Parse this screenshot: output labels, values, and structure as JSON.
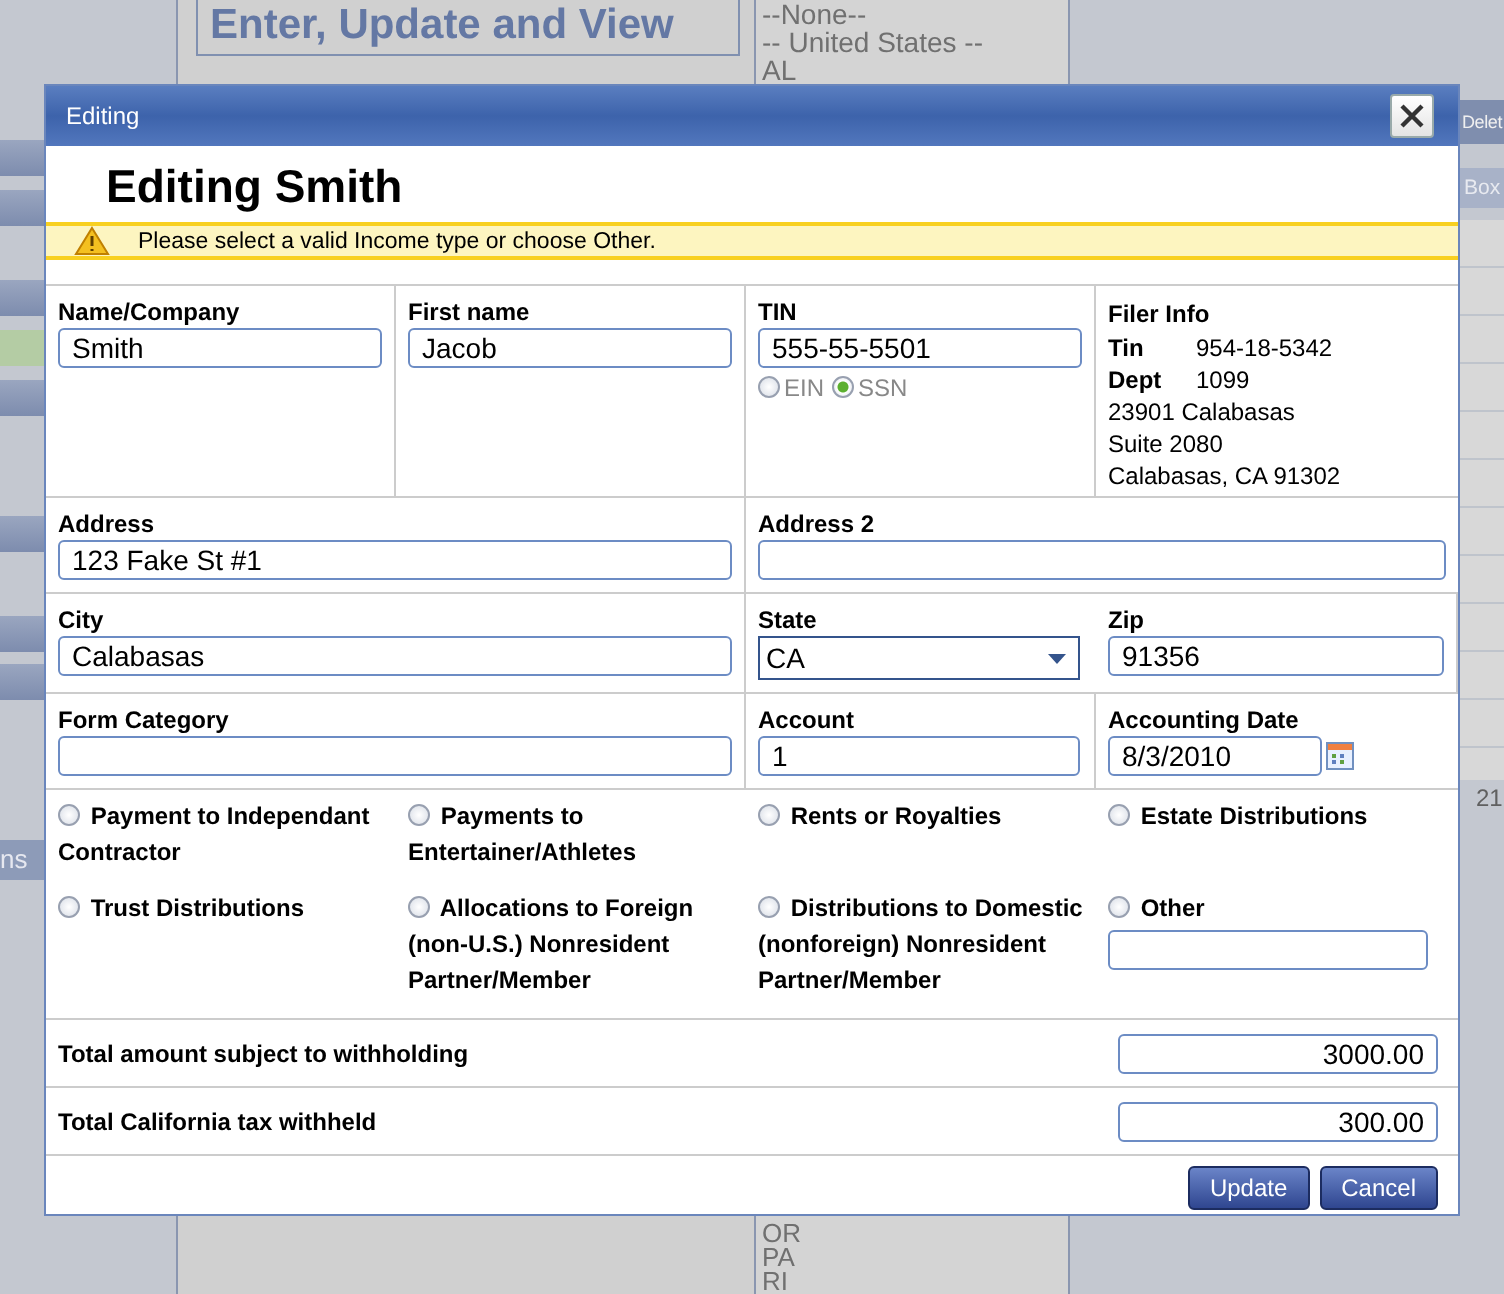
{
  "backdrop": {
    "page_title": "Enter, Update and View",
    "list_top": [
      "--None--",
      "-- United States --",
      "AL"
    ],
    "list_bottom": [
      "OR",
      "PA",
      "RI"
    ],
    "toolbar_button": "Delet",
    "column_header": "Box",
    "cell": "21",
    "side_label": "ns"
  },
  "dialog": {
    "title": "Editing",
    "heading": "Editing Smith",
    "warning": "Please select a valid Income type or choose Other.",
    "name": {
      "label": "Name/Company",
      "value": "Smith"
    },
    "first_name": {
      "label": "First name",
      "value": "Jacob"
    },
    "tin": {
      "label": "TIN",
      "value": "555-55-5501",
      "types": [
        {
          "label": "EIN",
          "selected": false
        },
        {
          "label": "SSN",
          "selected": true
        }
      ]
    },
    "filer_info": {
      "label": "Filer Info",
      "tin_label": "Tin",
      "tin": "954-18-5342",
      "dept_label": "Dept",
      "dept": "1099",
      "address_lines": [
        "23901 Calabasas",
        "Suite 2080",
        "Calabasas, CA 91302"
      ]
    },
    "address": {
      "label": "Address",
      "value": "123 Fake St #1"
    },
    "address2": {
      "label": "Address 2"
    },
    "city": {
      "label": "City",
      "value": "Calabasas"
    },
    "state": {
      "label": "State",
      "value": "CA"
    },
    "zip": {
      "label": "Zip",
      "value": "91356"
    },
    "form_category": {
      "label": "Form Category"
    },
    "account": {
      "label": "Account",
      "value": "1"
    },
    "accounting_date": {
      "label": "Accounting Date",
      "value": "8/3/2010"
    },
    "income_types": [
      {
        "label": "Payment to Independant Contractor",
        "selected": false
      },
      {
        "label": "Payments to Entertainer/Athletes",
        "selected": false
      },
      {
        "label": "Rents or Royalties",
        "selected": false
      },
      {
        "label": "Estate Distributions",
        "selected": false
      },
      {
        "label": "Trust Distributions",
        "selected": false
      },
      {
        "label": "Allocations to Foreign (non-U.S.) Nonresident Partner/Member",
        "selected": false
      },
      {
        "label": "Distributions to Domestic (nonforeign) Nonresident Partner/Member",
        "selected": false
      },
      {
        "label": "Other",
        "selected": false,
        "kind": "other"
      }
    ],
    "totals": [
      {
        "label": "Total amount subject to withholding",
        "value": "3000.00"
      },
      {
        "label": "Total California tax withheld",
        "value": "300.00"
      }
    ],
    "buttons": [
      "Update",
      "Cancel"
    ]
  }
}
